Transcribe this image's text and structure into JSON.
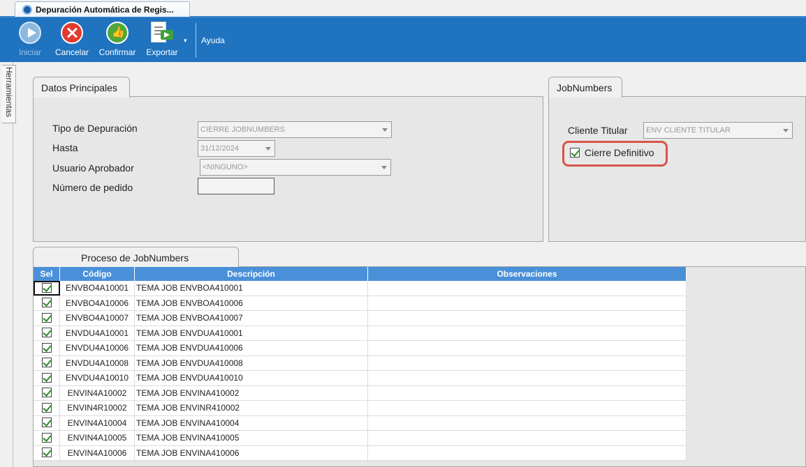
{
  "window": {
    "tab_title": "Depuración Automática de Regis..."
  },
  "toolbar": {
    "buttons": [
      {
        "label": "Iniciar",
        "icon": "play-icon",
        "enabled": false
      },
      {
        "label": "Cancelar",
        "icon": "cancel-icon",
        "enabled": true
      },
      {
        "label": "Confirmar",
        "icon": "thumbs-up-icon",
        "enabled": true
      },
      {
        "label": "Exportar",
        "icon": "export-icon",
        "enabled": true
      }
    ],
    "dropdown_glyph": "▾",
    "help_label": "Ayuda"
  },
  "side": {
    "herramientas_label": "Herramientas"
  },
  "datos": {
    "tab_label": "Datos Principales",
    "tipo_label": "Tipo de Depuración",
    "tipo_value": "CIERRE JOBNUMBERS",
    "hasta_label": "Hasta",
    "hasta_value": "31/12/2024",
    "usuario_label": "Usuario Aprobador",
    "usuario_value": "<NINGUNO>",
    "pedido_label": "Número de pedido",
    "pedido_value": ""
  },
  "jobnumbers": {
    "tab_label": "JobNumbers",
    "cliente_label": "Cliente Titular",
    "cliente_value": "ENV CLIENTE TITULAR",
    "cierre_label": "Cierre Definitivo",
    "cierre_checked": true
  },
  "grid": {
    "tab_label": "Proceso de JobNumbers",
    "columns": [
      "Sel",
      "Código",
      "Descripción",
      "Observaciones"
    ],
    "header_color": "#4a90d9",
    "rows": [
      {
        "sel": true,
        "codigo": "ENVBO4A10001",
        "descripcion": "TEMA JOB ENVBOA410001",
        "observaciones": ""
      },
      {
        "sel": true,
        "codigo": "ENVBO4A10006",
        "descripcion": "TEMA JOB ENVBOA410006",
        "observaciones": ""
      },
      {
        "sel": true,
        "codigo": "ENVBO4A10007",
        "descripcion": "TEMA JOB ENVBOA410007",
        "observaciones": ""
      },
      {
        "sel": true,
        "codigo": "ENVDU4A10001",
        "descripcion": "TEMA JOB ENVDUA410001",
        "observaciones": ""
      },
      {
        "sel": true,
        "codigo": "ENVDU4A10006",
        "descripcion": "TEMA JOB ENVDUA410006",
        "observaciones": ""
      },
      {
        "sel": true,
        "codigo": "ENVDU4A10008",
        "descripcion": "TEMA JOB ENVDUA410008",
        "observaciones": ""
      },
      {
        "sel": true,
        "codigo": "ENVDU4A10010",
        "descripcion": "TEMA JOB ENVDUA410010",
        "observaciones": ""
      },
      {
        "sel": true,
        "codigo": "ENVIN4A10002",
        "descripcion": "TEMA JOB ENVINA410002",
        "observaciones": ""
      },
      {
        "sel": true,
        "codigo": "ENVIN4R10002",
        "descripcion": "TEMA JOB ENVINR410002",
        "observaciones": ""
      },
      {
        "sel": true,
        "codigo": "ENVIN4A10004",
        "descripcion": "TEMA JOB ENVINA410004",
        "observaciones": ""
      },
      {
        "sel": true,
        "codigo": "ENVIN4A10005",
        "descripcion": "TEMA JOB ENVINA410005",
        "observaciones": ""
      },
      {
        "sel": true,
        "codigo": "ENVIN4A10006",
        "descripcion": "TEMA JOB ENVINA410006",
        "observaciones": ""
      }
    ]
  },
  "colors": {
    "toolbar": "#1f73bf",
    "highlight": "#d9534a",
    "check": "#2e8b2e"
  }
}
